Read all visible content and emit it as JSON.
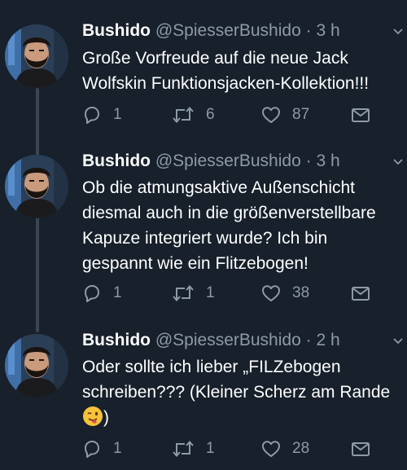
{
  "tweets": [
    {
      "name": "Bushido",
      "handle": "@SpiesserBushido",
      "separator": "·",
      "time": "3 h",
      "text_lines": [
        "Große Vorfreude auf die neue Jack",
        "Wolfskin Funktionsjacken-Kollektion!!!"
      ],
      "replies": "1",
      "retweets": "6",
      "likes": "87"
    },
    {
      "name": "Bushido",
      "handle": "@SpiesserBushido",
      "separator": "·",
      "time": "3 h",
      "text_lines": [
        "Ob die atmungsaktive Außenschicht",
        "diesmal auch in die größenverstellbare",
        "Kapuze integriert wurde? Ich bin",
        "gespannt wie ein Flitzebogen!"
      ],
      "replies": "1",
      "retweets": "1",
      "likes": "38"
    },
    {
      "name": "Bushido",
      "handle": "@SpiesserBushido",
      "separator": "·",
      "time": "2 h",
      "text_lines": [
        "Oder sollte ich lieber „FILZebogen",
        "schreiben??? (Kleiner Scherz am Rande",
        ")"
      ],
      "emoji": "winking-face-tongue-emoji",
      "replies": "1",
      "retweets": "1",
      "likes": "28"
    }
  ],
  "icons": {
    "reply": "reply-icon",
    "retweet": "retweet-icon",
    "like": "heart-icon",
    "share": "mail-icon",
    "menu": "chevron-down-icon"
  },
  "colors": {
    "background": "#17202b",
    "secondary_text": "#8d9aa7",
    "thread_line": "#3a4653"
  }
}
